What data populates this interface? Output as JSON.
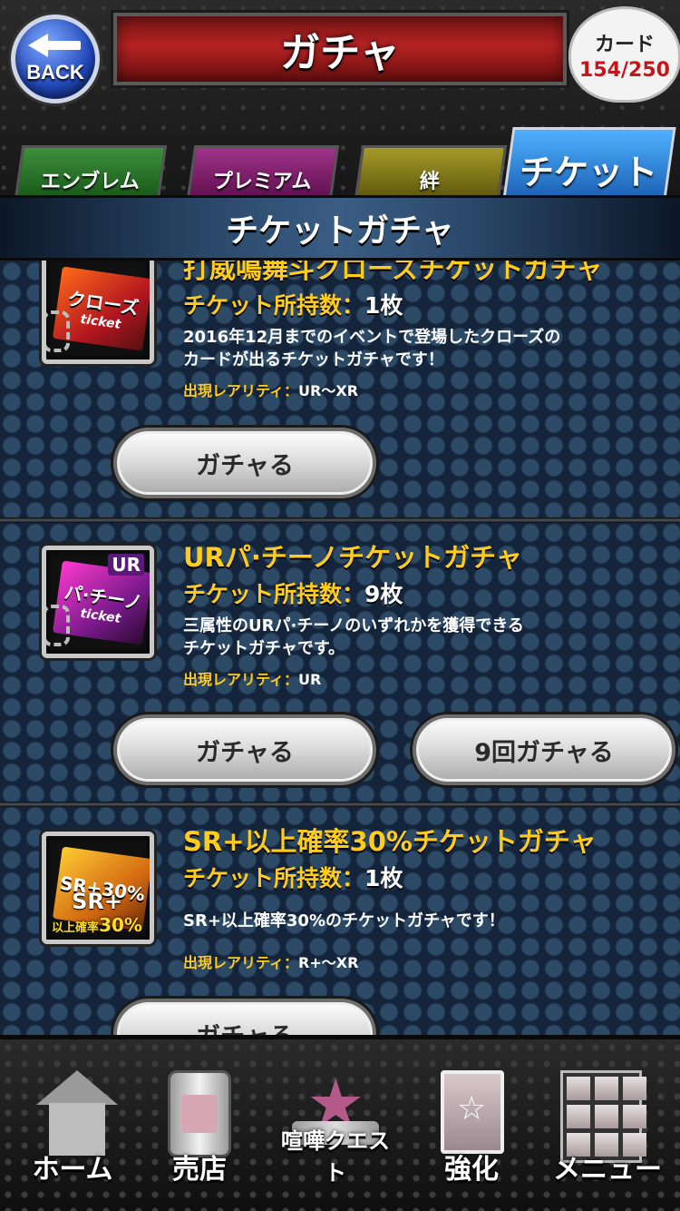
{
  "header": {
    "back_label": "BACK",
    "title": "ガチャ",
    "card_label": "カード",
    "card_count": "154/250"
  },
  "tabs": [
    {
      "label": "エンブレム",
      "active": false
    },
    {
      "label": "プレミアム",
      "active": false
    },
    {
      "label": "絆",
      "active": false
    },
    {
      "label": "チケット",
      "active": true
    }
  ],
  "section_title": "チケットガチャ",
  "items": [
    {
      "title": "打威鳴舞斗クローズチケットガチャ",
      "count_label": "チケット所持数：",
      "count_value": "1枚",
      "desc_line1": "2016年12月までのイベントで登場したクローズの",
      "desc_line2": "カードが出るチケットガチャです！",
      "rarity_label": "出現レアリティ：",
      "rarity_value": "UR〜XR",
      "thumb_main": "クローズ",
      "thumb_sub": "ticket",
      "button": "ガチャる"
    },
    {
      "title": "URパ·チーノチケットガチャ",
      "count_label": "チケット所持数：",
      "count_value": "9枚",
      "desc_line1": "三属性のURパ·チーノのいずれかを獲得できる",
      "desc_line2": "チケットガチャです。",
      "rarity_label": "出現レアリティ：",
      "rarity_value": "UR",
      "thumb_main": "パ·チーノ",
      "thumb_sub": "ticket",
      "thumb_badge": "UR",
      "button": "ガチャる",
      "button_multi": "9回ガチャる"
    },
    {
      "title": "SR+以上確率30%チケットガチャ",
      "count_label": "チケット所持数：",
      "count_value": "1枚",
      "desc_line1": "SR+以上確率30%のチケットガチャです！",
      "rarity_label": "出現レアリティ：",
      "rarity_value": "R+〜XR",
      "thumb_main": "SR+30%",
      "thumb_badge_top": "SR+",
      "thumb_badge_mid": "以上確率",
      "thumb_badge_pct": "30%",
      "button": "ガチャる"
    }
  ],
  "nav": [
    {
      "label": "ホーム",
      "icon": "home-icon"
    },
    {
      "label": "売店",
      "icon": "shop-icon"
    },
    {
      "label": "喧嘩クエスト",
      "icon": "quest-icon"
    },
    {
      "label": "強化",
      "icon": "enhance-icon"
    },
    {
      "label": "メニュー",
      "icon": "menu-icon"
    }
  ]
}
